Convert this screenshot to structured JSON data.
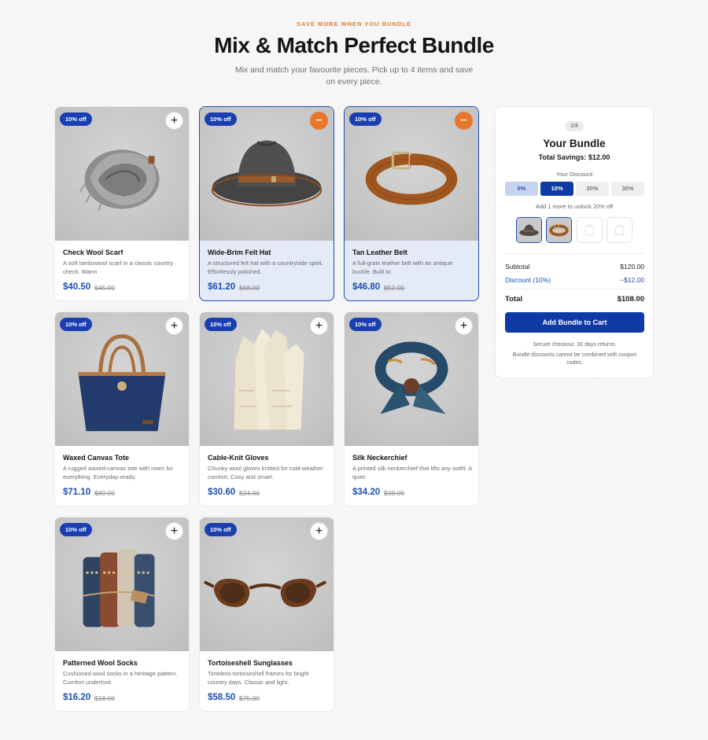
{
  "header": {
    "eyebrow": "SAVE MORE WHEN YOU BUNDLE",
    "title": "Mix & Match Perfect Bundle",
    "subtitle": "Mix and match your favourite pieces. Pick up to 4 items and save on every piece."
  },
  "products": [
    {
      "name": "Check Wool Scarf",
      "desc": "A soft lambswool scarf in a classic country check. Warm",
      "price": "$40.50",
      "old_price": "$45.00",
      "badge": "10% off",
      "selected": false,
      "icon": "scarf-icon",
      "toggle": "+"
    },
    {
      "name": "Wide-Brim Felt Hat",
      "desc": "A structured felt hat with a countryside spirit. Effortlessly polished.",
      "price": "$61.20",
      "old_price": "$68.00",
      "badge": "10% off",
      "selected": true,
      "icon": "hat-icon",
      "toggle": "−"
    },
    {
      "name": "Tan Leather Belt",
      "desc": "A full-grain leather belt with an antique buckle. Built to",
      "price": "$46.80",
      "old_price": "$52.00",
      "badge": "10% off",
      "selected": true,
      "icon": "belt-icon",
      "toggle": "−"
    },
    {
      "name": "Waxed Canvas Tote",
      "desc": "A rugged waxed-canvas tote with room for everything. Everyday-ready.",
      "price": "$71.10",
      "old_price": "$89.00",
      "badge": "10% off",
      "selected": false,
      "icon": "tote-icon",
      "toggle": "+"
    },
    {
      "name": "Cable-Knit Gloves",
      "desc": "Chunky wool gloves knitted for cold-weather comfort. Cosy and smart.",
      "price": "$30.60",
      "old_price": "$34.00",
      "badge": "10% off",
      "selected": false,
      "icon": "gloves-icon",
      "toggle": "+"
    },
    {
      "name": "Silk Neckerchief",
      "desc": "A printed silk neckerchief that lifts any outfit. A quiet",
      "price": "$34.20",
      "old_price": "$38.00",
      "badge": "10% off",
      "selected": false,
      "icon": "neckerchief-icon",
      "toggle": "+"
    },
    {
      "name": "Patterned Wool Socks",
      "desc": "Cushioned wool socks in a heritage pattern. Comfort underfoot.",
      "price": "$16.20",
      "old_price": "$18.00",
      "badge": "10% off",
      "selected": false,
      "icon": "socks-icon",
      "toggle": "+"
    },
    {
      "name": "Tortoiseshell Sunglasses",
      "desc": "Timeless tortoiseshell frames for bright country days. Classic and light.",
      "price": "$58.50",
      "old_price": "$75.00",
      "badge": "10% off",
      "selected": false,
      "icon": "sunglasses-icon",
      "toggle": "+"
    }
  ],
  "bundle": {
    "count": "2/4",
    "title": "Your Bundle",
    "savings": "Total Savings: $12.00",
    "discount_label": "Your Discount",
    "tiers": [
      "0%",
      "10%",
      "20%",
      "30%"
    ],
    "active_tier": 1,
    "unlock_text": "Add 1 more to unlock 20% off",
    "slots_filled": 2,
    "slots_total": 4,
    "subtotal_label": "Subtotal",
    "subtotal": "$120.00",
    "discount_row_label": "Discount (10%)",
    "discount_value": "−$12.00",
    "total_label": "Total",
    "total": "$108.00",
    "cta": "Add Bundle to Cart",
    "note1": "Secure checkout. 30 days returns.",
    "note2": "Bundle discounts cannot be combined with coupon codes."
  },
  "colors": {
    "accent": "#0f3aa6",
    "price": "#1c4fb4",
    "remove": "#e8772e",
    "eyebrow": "#e07b2e"
  }
}
